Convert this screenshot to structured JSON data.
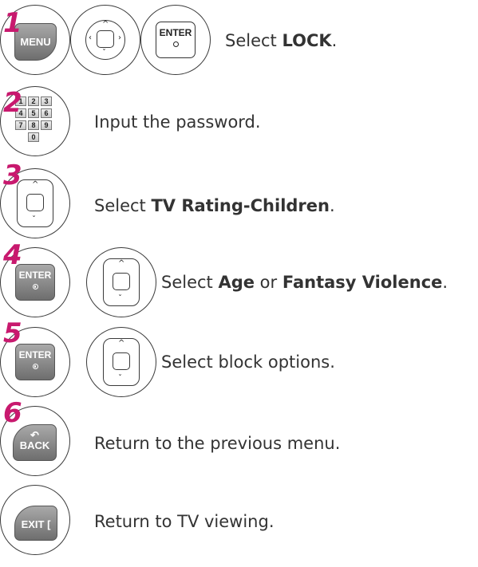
{
  "steps": [
    {
      "number": "1",
      "text_pre": "Select ",
      "text_bold": "LOCK",
      "text_post": "."
    },
    {
      "number": "2",
      "text_pre": "Input the password.",
      "text_bold": "",
      "text_post": ""
    },
    {
      "number": "3",
      "text_pre": "Select ",
      "text_bold": "TV Rating-Children",
      "text_post": "."
    },
    {
      "number": "4",
      "text_pre": "Select ",
      "text_bold": "Age",
      "text_mid": " or ",
      "text_bold2": "Fantasy Violence",
      "text_post": "."
    },
    {
      "number": "5",
      "text_pre": "Select block options.",
      "text_bold": "",
      "text_post": ""
    },
    {
      "number": "6",
      "text_pre": "Return to the previous menu.",
      "text_bold": "",
      "text_post": ""
    },
    {
      "number": "",
      "text_pre": "Return to TV viewing.",
      "text_bold": "",
      "text_post": ""
    }
  ],
  "buttons": {
    "menu": "MENU",
    "enter": "ENTER",
    "back": "BACK",
    "exit": "EXIT",
    "keys": [
      "1",
      "2",
      "3",
      "4",
      "5",
      "6",
      "7",
      "8",
      "9",
      "0"
    ]
  },
  "colors": {
    "step_number": "#c8196e",
    "button_fill": "#8a8a8a"
  }
}
